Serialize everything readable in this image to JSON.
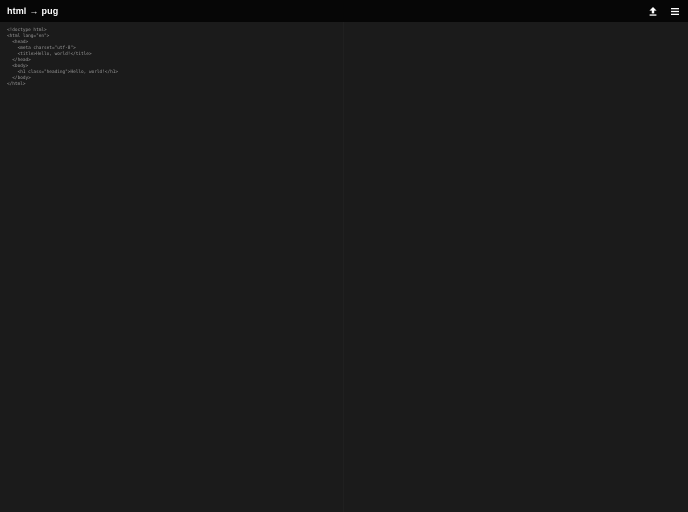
{
  "header": {
    "title_from": "html",
    "title_arrow": "→",
    "title_to": "pug",
    "upload_icon": "upload-icon",
    "menu_icon": "hamburger-menu-icon"
  },
  "editor": {
    "code": "<!doctype html>\n<html lang=\"en\">\n  <head>\n    <meta charset=\"utf-8\">\n    <title>Hello, world!</title>\n  </head>\n  <body>\n    <h1 class=\"heading\">Hello, world!</h1>\n  </body>\n</html>"
  },
  "output": {
    "code": ""
  },
  "colors": {
    "header_bg": "#060606",
    "panel_bg": "#1b1b1b",
    "code_text": "#9a9a9a",
    "title_text": "#ffffff"
  }
}
